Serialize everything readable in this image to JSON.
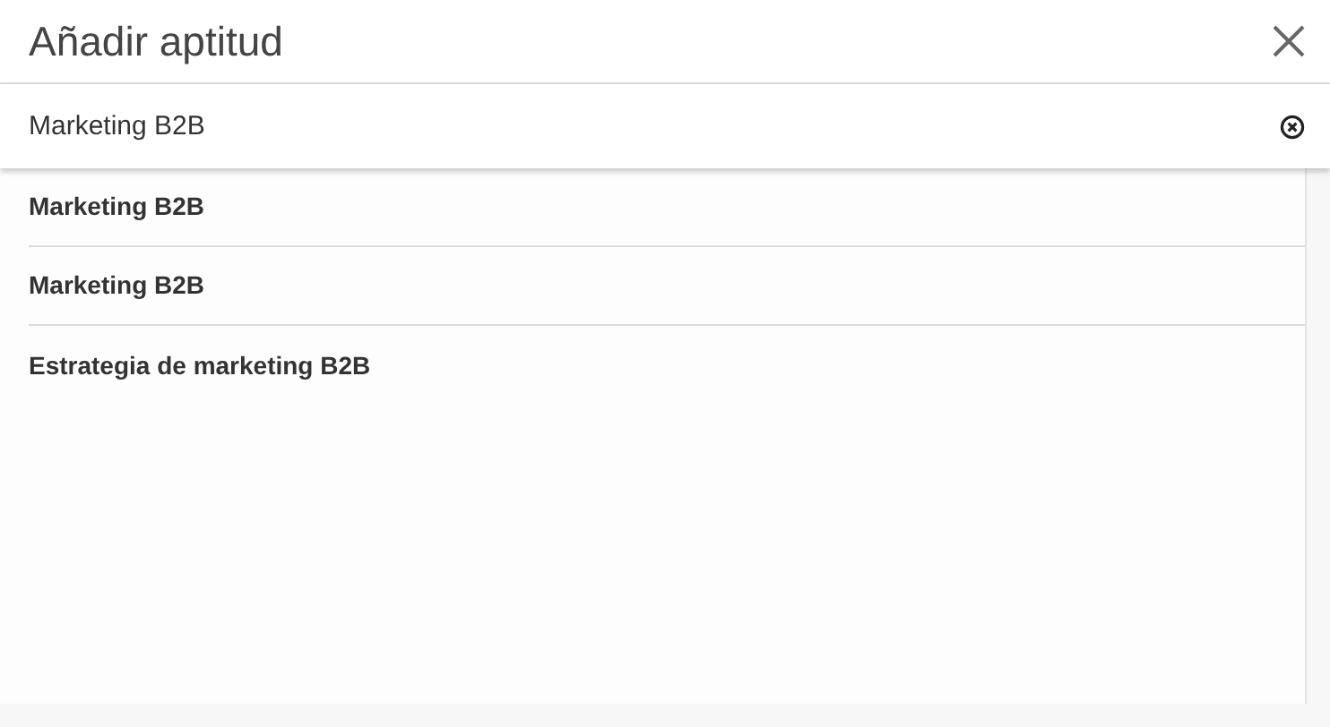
{
  "window": {
    "title": "Añadir aptitud"
  },
  "search": {
    "value": "Marketing B2B"
  },
  "suggestions": [
    {
      "label": "Marketing B2B"
    },
    {
      "label": "Marketing B2B"
    },
    {
      "label": "Estrategia de marketing B2B"
    }
  ]
}
